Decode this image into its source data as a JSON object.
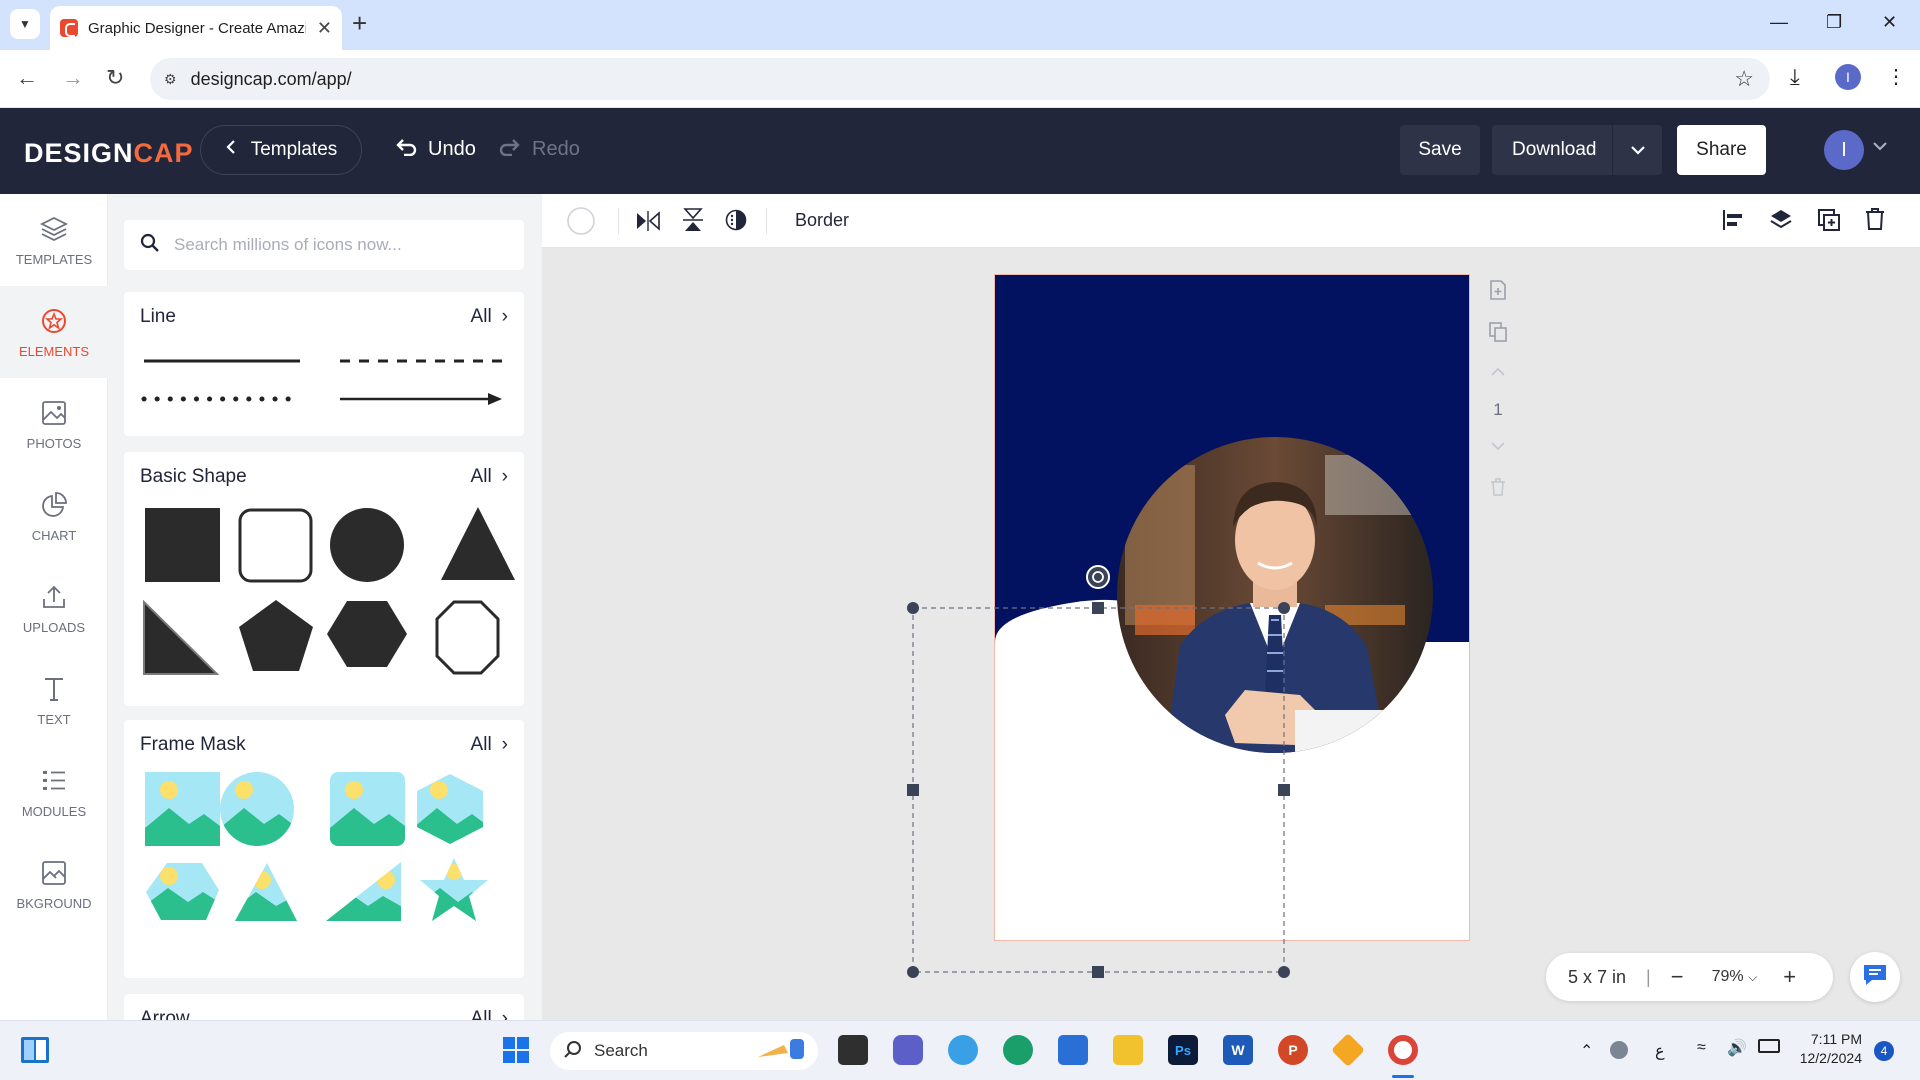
{
  "browser": {
    "tab_title": "Graphic Designer - Create Amazing Graphic Designs",
    "url": "designcap.com/app/",
    "profile_initial": "I"
  },
  "app": {
    "logo_part1": "DESIGN",
    "logo_part2": "CAP",
    "templates_label": "Templates",
    "undo_label": "Undo",
    "redo_label": "Redo",
    "save_label": "Save",
    "download_label": "Download",
    "share_label": "Share",
    "user_initial": "I",
    "brand_color": "#f36a3f",
    "header_color": "#22263a"
  },
  "rail": {
    "items": [
      {
        "label": "TEMPLATES",
        "icon": "layers-icon"
      },
      {
        "label": "ELEMENTS",
        "icon": "elements-icon"
      },
      {
        "label": "PHOTOS",
        "icon": "photo-icon"
      },
      {
        "label": "CHART",
        "icon": "pie-chart-icon"
      },
      {
        "label": "UPLOADS",
        "icon": "upload-icon"
      },
      {
        "label": "TEXT",
        "icon": "text-icon"
      },
      {
        "label": "MODULES",
        "icon": "list-icon"
      },
      {
        "label": "BKGROUND",
        "icon": "background-icon"
      }
    ],
    "active": "ELEMENTS"
  },
  "panel": {
    "search_placeholder": "Search millions of icons now...",
    "sections": [
      {
        "title": "Line",
        "all_label": "All"
      },
      {
        "title": "Basic Shape",
        "all_label": "All"
      },
      {
        "title": "Frame Mask",
        "all_label": "All"
      },
      {
        "title": "Arrow",
        "all_label": "All"
      }
    ]
  },
  "toolbar": {
    "border_label": "Border"
  },
  "canvas": {
    "page_number": "1",
    "page_size": "5 x 7 in",
    "zoom": "79%",
    "background_top_color": "#031260"
  },
  "taskbar": {
    "search_label": "Search",
    "time": "7:11 PM",
    "date": "12/2/2024",
    "notification_count": "4",
    "lang": "ع"
  }
}
